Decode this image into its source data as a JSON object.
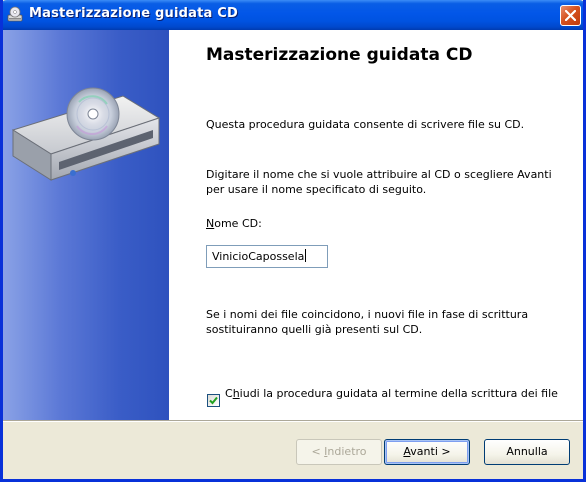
{
  "window": {
    "title": "Masterizzazione guidata CD",
    "close_icon": "close-icon"
  },
  "wizard": {
    "heading": "Masterizzazione guidata CD",
    "intro": "Questa procedura guidata consente di scrivere file su CD.",
    "instruction": "Digitare il nome che si vuole attribuire al CD o scegliere Avanti per usare il nome specificato di seguito.",
    "name_label_accel": "N",
    "name_label_rest": "ome CD:",
    "name_value": "VinicioCapossela",
    "warning": "Se i nomi dei file coincidono, i nuovi file in fase di scrittura sostituiranno quelli già presenti sul CD.",
    "checkbox_pre": "C",
    "checkbox_accel": "h",
    "checkbox_post": "iudi la procedura guidata al termine della scrittura dei file",
    "checkbox_checked": true
  },
  "buttons": {
    "back_pre": "< ",
    "back_accel": "I",
    "back_post": "ndietro",
    "next_accel": "A",
    "next_post": "vanti >",
    "cancel": "Annulla"
  },
  "colors": {
    "titlebar": "#0053e1",
    "sidebar": "#3a5dc7",
    "face": "#ece9d8",
    "close": "#d6521f"
  }
}
